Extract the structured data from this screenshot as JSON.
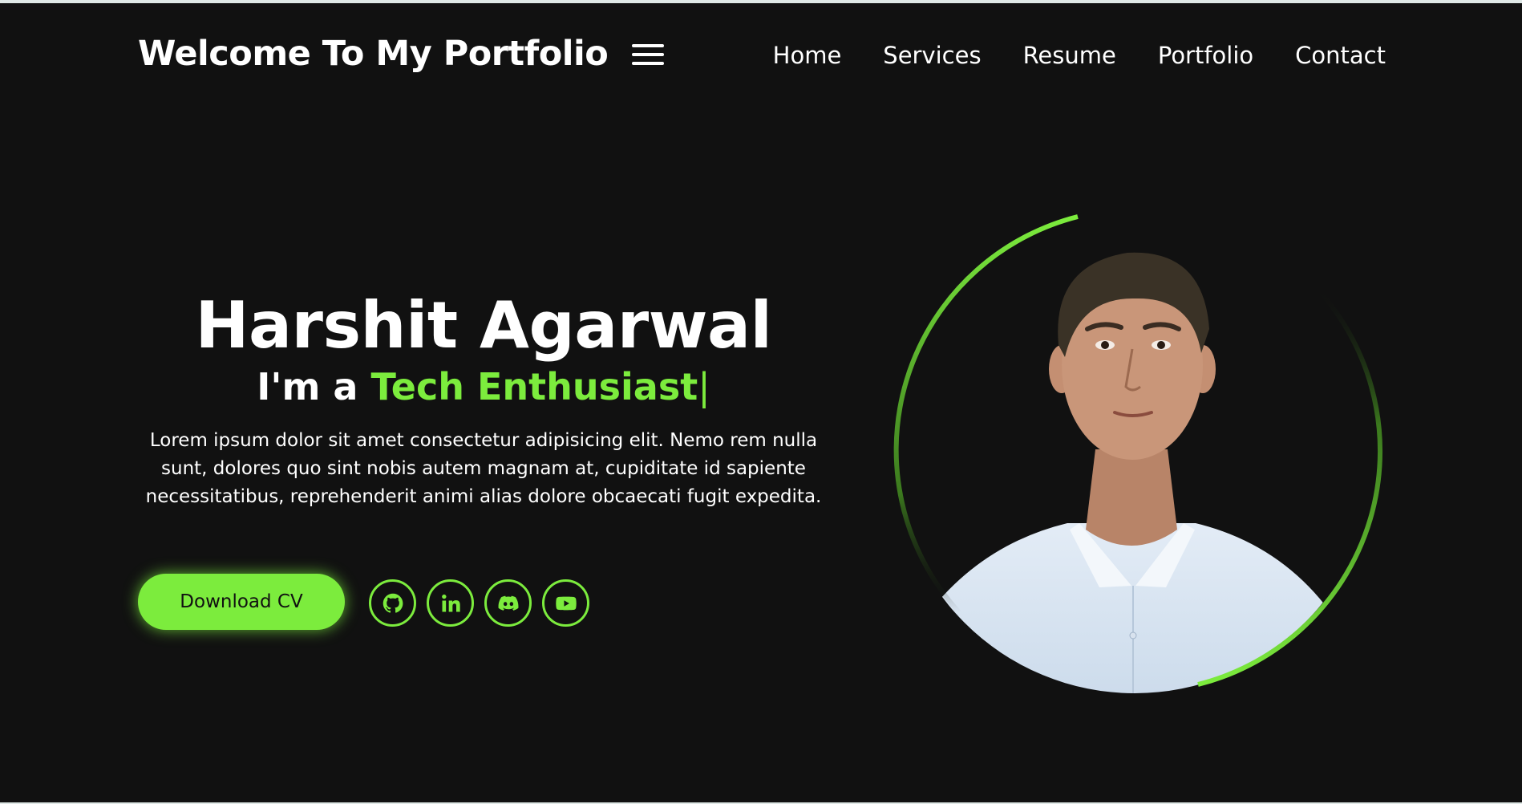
{
  "header": {
    "brand": "Welcome To My Portfolio",
    "nav": [
      "Home",
      "Services",
      "Resume",
      "Portfolio",
      "Contact"
    ]
  },
  "hero": {
    "name": "Harshit Agarwal",
    "role_prefix": "I'm a",
    "role_highlight": "Tech Enthusiast",
    "cursor": "|",
    "description": "Lorem ipsum dolor sit amet consectetur adipisicing elit. Nemo rem nulla sunt, dolores quo sint nobis autem magnam at, cupiditate id sapiente necessitatibus, reprehenderit animi alias dolore obcaecati fugit expedita.",
    "cta_label": "Download CV"
  },
  "socials": [
    "github-icon",
    "linkedin-icon",
    "discord-icon",
    "youtube-icon"
  ],
  "colors": {
    "background": "#111111",
    "accent": "#7cec3d",
    "text": "#ffffff"
  }
}
